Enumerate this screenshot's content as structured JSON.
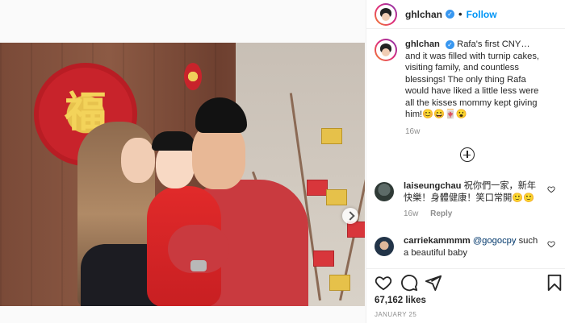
{
  "post": {
    "username": "ghlchan",
    "follow_label": "Follow",
    "separator": "•",
    "caption": "Rafa's first CNY…and it was filled with turnip cakes, visiting family, and countless blessings! The only thing Rafa would have liked a little less were all the kisses mommy kept giving him!😊😄🀄😮",
    "caption_time": "16w",
    "likes": "67,162 likes",
    "date": "JANUARY 25",
    "photo_char": "福"
  },
  "comments": [
    {
      "username": "laiseungchau",
      "text": "祝你們一家，新年快樂！身體健康！笑口常開🙂🙂",
      "time": "16w",
      "reply_label": "Reply"
    },
    {
      "username": "carriekammmm",
      "mention": "@gogocpy",
      "text": " such a beautiful baby"
    }
  ],
  "icons": {
    "verified": "verified-badge-icon",
    "like": "heart-icon",
    "comment": "speech-bubble-icon",
    "share": "paper-plane-icon",
    "save": "bookmark-icon",
    "load_more": "plus-circle-icon",
    "next": "chevron-right-icon"
  },
  "colors": {
    "follow": "#0095f6",
    "verified": "#3897f0",
    "muted": "#8e8e8e"
  }
}
